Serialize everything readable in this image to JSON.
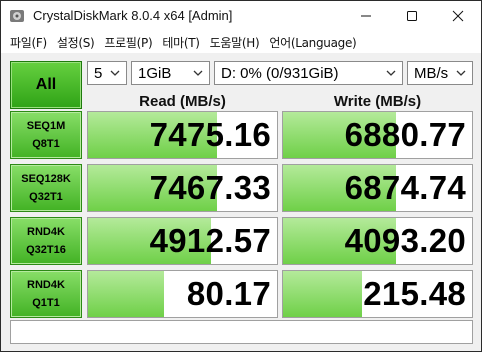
{
  "window": {
    "title": "CrystalDiskMark 8.0.4 x64 [Admin]",
    "controls": {
      "minimize": "minimize-icon",
      "maximize": "maximize-icon",
      "close": "close-icon"
    }
  },
  "menu": [
    "파일(F)",
    "설정(S)",
    "프로필(P)",
    "테마(T)",
    "도움말(H)",
    "언어(Language)"
  ],
  "toolbar": {
    "all_label": "All",
    "count": "5",
    "size": "1GiB",
    "drive": "D: 0% (0/931GiB)",
    "unit": "MB/s"
  },
  "headers": {
    "read": "Read (MB/s)",
    "write": "Write (MB/s)"
  },
  "tests": [
    {
      "line1": "SEQ1M",
      "line2": "Q8T1",
      "read": "7475.16",
      "write": "6880.77",
      "read_fill": 0.68,
      "write_fill": 0.6
    },
    {
      "line1": "SEQ128K",
      "line2": "Q32T1",
      "read": "7467.33",
      "write": "6874.74",
      "read_fill": 0.68,
      "write_fill": 0.6
    },
    {
      "line1": "RND4K",
      "line2": "Q32T16",
      "read": "4912.57",
      "write": "4093.20",
      "read_fill": 0.65,
      "write_fill": 0.6
    },
    {
      "line1": "RND4K",
      "line2": "Q1T1",
      "read": "80.17",
      "write": "215.48",
      "read_fill": 0.4,
      "write_fill": 0.42
    }
  ],
  "comment": ""
}
